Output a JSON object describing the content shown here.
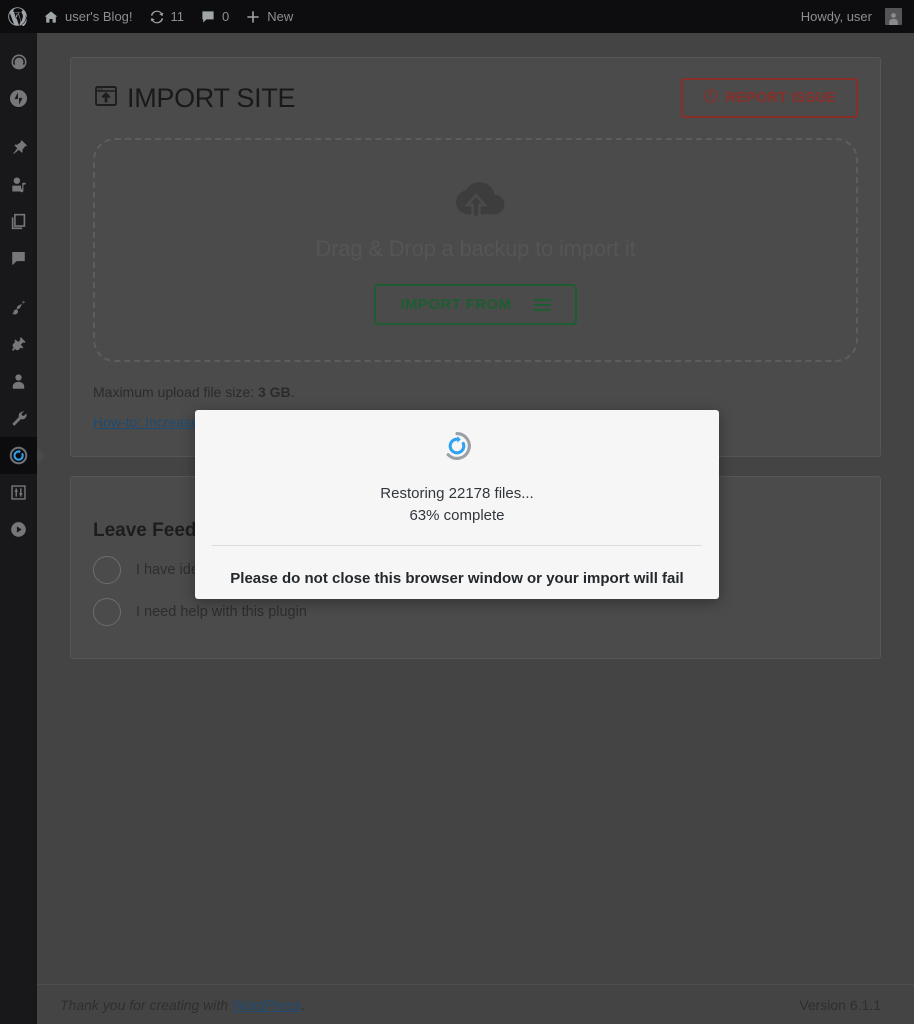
{
  "adminbar": {
    "logo_icon": "wordpress-icon",
    "site_icon": "home-icon",
    "site_name": "user's Blog!",
    "updates_icon": "updates-icon",
    "updates_count": "11",
    "comments_icon": "comment-bubble-icon",
    "comments_count": "0",
    "new_icon": "plus-icon",
    "new_label": "New",
    "howdy": "Howdy, user",
    "avatar_icon": "avatar-icon"
  },
  "sidebar": {
    "items": [
      {
        "name": "dashboard",
        "icon": "dashboard-gauge-icon",
        "active": false
      },
      {
        "name": "jetpack",
        "icon": "jetpack-icon",
        "active": false
      },
      {
        "name": "posts",
        "icon": "pushpin-icon",
        "active": false
      },
      {
        "name": "media",
        "icon": "media-music-icon",
        "active": false
      },
      {
        "name": "pages",
        "icon": "pages-stack-icon",
        "active": false
      },
      {
        "name": "comments",
        "icon": "comment-bubble-icon",
        "active": false
      },
      {
        "name": "appearance",
        "icon": "paintbrush-icon",
        "active": false
      },
      {
        "name": "plugins",
        "icon": "plug-icon",
        "active": false
      },
      {
        "name": "users",
        "icon": "user-icon",
        "active": false
      },
      {
        "name": "tools",
        "icon": "wrench-icon",
        "active": false
      },
      {
        "name": "all-in-one-wp-migration",
        "icon": "restore-circle-icon",
        "active": true
      },
      {
        "name": "settings",
        "icon": "sliders-icon",
        "active": false
      },
      {
        "name": "collapse-menu",
        "icon": "play-circle-icon",
        "active": false
      }
    ]
  },
  "import_card": {
    "title_icon": "import-window-arrow-icon",
    "title": "IMPORT SITE",
    "report_button": {
      "icon": "exclamation-circle-icon",
      "label": "REPORT ISSUE"
    },
    "dropzone": {
      "icon": "cloud-upload-icon",
      "text": "Drag & Drop a backup to import it",
      "import_button_label": "IMPORT FROM",
      "import_button_icon": "hamburger-menu-icon"
    },
    "max_upload_prefix": "Maximum upload file size: ",
    "max_upload_value": "3 GB",
    "max_upload_suffix": ".",
    "howto_link": "How-to: Increase maximum upload file size"
  },
  "feedback_card": {
    "heading": "Leave Feedback",
    "options": [
      "I have ideas to improve this plugin",
      "I need help with this plugin"
    ]
  },
  "modal": {
    "spinner_icon": "restore-spinner-icon",
    "status": "Restoring 22178 files...",
    "progress": "63% complete",
    "warning": "Please do not close this browser window or your import will fail",
    "percent_value": "63",
    "file_count": "22178"
  },
  "footer": {
    "thanks_prefix": "Thank you for creating with ",
    "thanks_link": "WordPress",
    "thanks_suffix": ".",
    "version": "Version 6.1.1"
  },
  "colors": {
    "admin_bar": "#0d0d0f",
    "sidebar": "#18181a",
    "content_bg": "#444444",
    "card_bg": "#4b4b4b",
    "accent_green": "#1e5d31",
    "accent_red": "#8a2e2a",
    "link_blue": "#1f4a72",
    "spinner_blue": "#2ea3f2",
    "modal_bg": "#f6f6f6"
  }
}
